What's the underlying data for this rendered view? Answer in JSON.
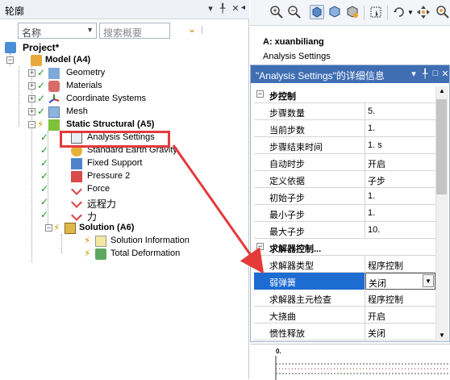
{
  "outline": {
    "title": "轮廓",
    "title_controls": [
      "▾",
      "╀",
      "✕",
      "◂"
    ],
    "name_combo": "名称",
    "search_placeholder": "搜索概要",
    "tree": [
      {
        "label": "Project*",
        "bold": true,
        "icon": "project-icon"
      },
      {
        "label": "Model (A4)",
        "bold": true,
        "icon": "model-icon"
      },
      {
        "label": "Geometry",
        "icon": "geometry-icon"
      },
      {
        "label": "Materials",
        "icon": "materials-icon"
      },
      {
        "label": "Coordinate Systems",
        "icon": "coordinate-systems-icon"
      },
      {
        "label": "Mesh",
        "icon": "mesh-icon"
      },
      {
        "label": "Static Structural (A5)",
        "bold": true,
        "icon": "static-structural-icon"
      },
      {
        "label": "Analysis Settings",
        "icon": "analysis-settings-icon"
      },
      {
        "label": "Standard Earth Gravity",
        "icon": "gravity-icon"
      },
      {
        "label": "Fixed Support",
        "icon": "fixed-support-icon"
      },
      {
        "label": "Pressure 2",
        "icon": "pressure-icon"
      },
      {
        "label": "Force",
        "icon": "force-icon"
      },
      {
        "label": "远程力",
        "icon": "remote-force-icon"
      },
      {
        "label": "力",
        "icon": "force-icon"
      },
      {
        "label": "Solution (A6)",
        "bold": true,
        "icon": "solution-icon"
      },
      {
        "label": "Solution Information",
        "icon": "solution-information-icon"
      },
      {
        "label": "Total Deformation",
        "icon": "total-deformation-icon"
      }
    ]
  },
  "header": {
    "name": "A: xuanbiliang",
    "subtitle": "Analysis Settings"
  },
  "details": {
    "title": "\"Analysis Settings\"的详细信息",
    "title_controls": [
      "▾",
      "╀",
      "□",
      "✕"
    ],
    "rows": [
      {
        "section": true,
        "label": "步控制"
      },
      {
        "label": "步骤数量",
        "value": "5."
      },
      {
        "label": "当前步数",
        "value": "1."
      },
      {
        "label": "步骤结束时间",
        "value": "1. s"
      },
      {
        "label": "自动时步",
        "value": "开启"
      },
      {
        "label": "定义依据",
        "value": "子步"
      },
      {
        "label": "初始子步",
        "value": "1."
      },
      {
        "label": "最小子步",
        "value": "1."
      },
      {
        "label": "最大子步",
        "value": "10."
      },
      {
        "section": true,
        "label": "求解器控制..."
      },
      {
        "label": "求解器类型",
        "value": "程序控制"
      },
      {
        "label": "弱弹簧",
        "value": "关闭",
        "selected": true,
        "dropdown": true
      },
      {
        "label": "求解器主元检查",
        "value": "程序控制"
      },
      {
        "label": "大挠曲",
        "value": "开启"
      },
      {
        "label": "惯性释放",
        "value": "关闭"
      }
    ]
  },
  "graph": {
    "y0": "0.",
    "y1": "0."
  },
  "colors": {
    "details_title_bg": "#3f6eb3",
    "selected_row": "#1c6cd2",
    "annotation": "#e43a3a",
    "check": "#1a9a1a"
  }
}
